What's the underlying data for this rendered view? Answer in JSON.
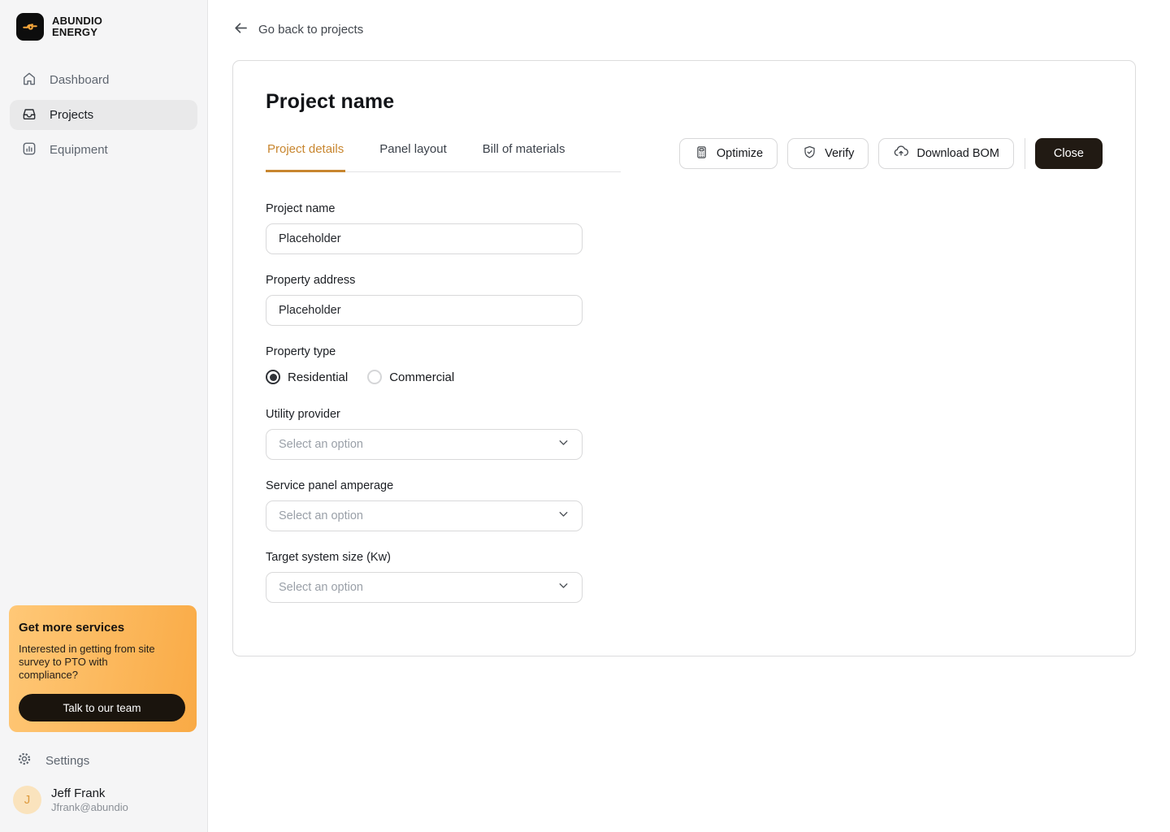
{
  "sidebar": {
    "logo": {
      "line1": "ABUNDIO",
      "line2": "ENERGY",
      "icon": "knot-logo-icon",
      "accent": "#f5a63b"
    },
    "items": [
      {
        "label": "Dashboard",
        "icon": "home-icon",
        "active": false
      },
      {
        "label": "Projects",
        "icon": "inbox-icon",
        "active": true
      },
      {
        "label": "Equipment",
        "icon": "bar-chart-icon",
        "active": false
      }
    ],
    "promo": {
      "title": "Get more services",
      "body": "Interested in getting from site survey to PTO with compliance?",
      "cta": "Talk to our team",
      "gradient_start": "#ffc877",
      "gradient_end": "#f9aa45"
    },
    "settings_label": "Settings",
    "user": {
      "initial": "J",
      "name": "Jeff Frank",
      "email": "Jfrank@abundio"
    }
  },
  "header": {
    "back_label": "Go back to projects"
  },
  "main": {
    "title": "Project name",
    "tabs": [
      {
        "label": "Project details",
        "active": true
      },
      {
        "label": "Panel layout",
        "active": false
      },
      {
        "label": "Bill of materials",
        "active": false
      }
    ],
    "actions": {
      "optimize": "Optimize",
      "verify": "Verify",
      "download_bom": "Download BOM",
      "close": "Close"
    },
    "form": {
      "project_name": {
        "label": "Project name",
        "value": "Placeholder"
      },
      "property_address": {
        "label": "Property address",
        "value": "Placeholder"
      },
      "property_type": {
        "label": "Property type",
        "options": [
          {
            "label": "Residential",
            "selected": true
          },
          {
            "label": "Commercial",
            "selected": false
          }
        ]
      },
      "utility_provider": {
        "label": "Utility provider",
        "placeholder": "Select an option"
      },
      "service_panel_amperage": {
        "label": "Service panel amperage",
        "placeholder": "Select an option"
      },
      "target_system_size": {
        "label": "Target system size (Kw)",
        "placeholder": "Select an option"
      }
    }
  },
  "colors": {
    "accent_tab": "#c8862f",
    "dark_button": "#211a13",
    "sidebar_bg": "#f5f5f6"
  }
}
